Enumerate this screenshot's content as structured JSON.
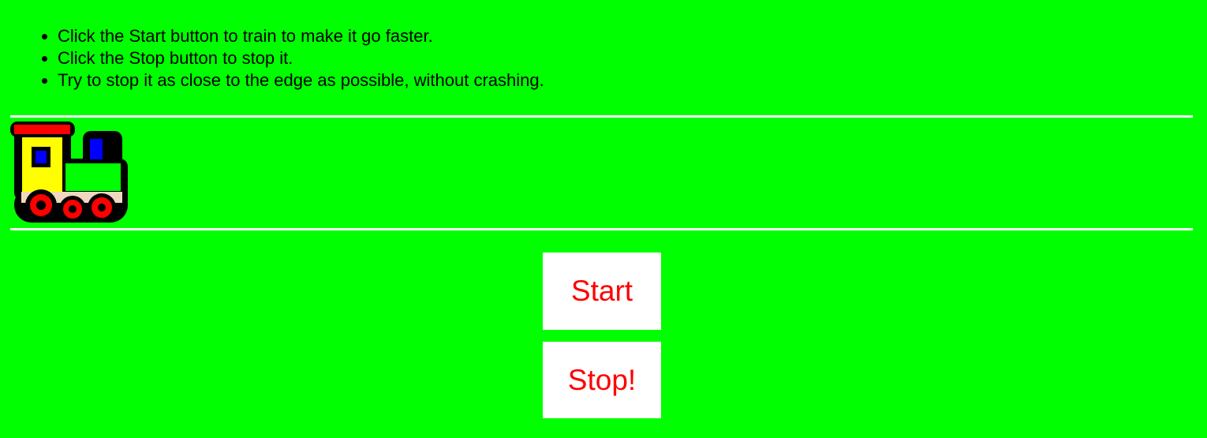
{
  "instructions": [
    "Click the Start button to train to make it go faster.",
    "Click the Stop button to stop it.",
    "Try to stop it as close to the edge as possible, without crashing."
  ],
  "train": {
    "icon": "toy-train-icon"
  },
  "controls": {
    "start_label": "Start",
    "stop_label": "Stop!"
  },
  "colors": {
    "background": "#00ff00",
    "track_line": "#ffffff",
    "button_bg": "#ffffff",
    "button_text": "#ff0000"
  }
}
